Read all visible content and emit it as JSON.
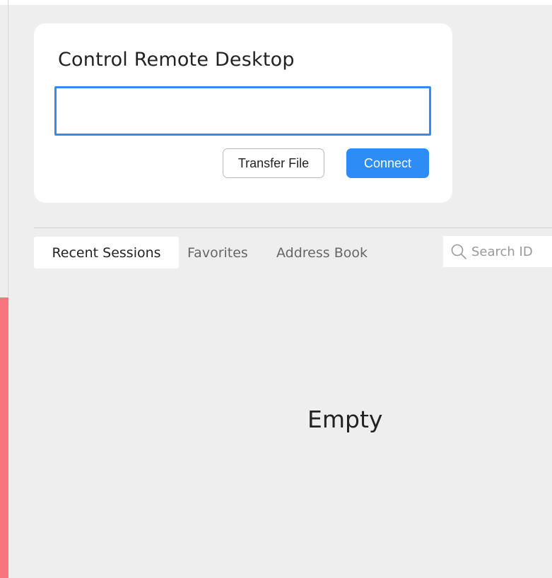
{
  "connect_card": {
    "title": "Control Remote Desktop",
    "id_input_value": "",
    "transfer_file_label": "Transfer File",
    "connect_label": "Connect"
  },
  "sessions": {
    "tabs": [
      {
        "label": "Recent Sessions",
        "active": true
      },
      {
        "label": "Favorites",
        "active": false
      },
      {
        "label": "Address Book",
        "active": false
      }
    ],
    "search_placeholder": "Search ID",
    "empty_message": "Empty"
  },
  "colors": {
    "accent_blue": "#2d8cf6",
    "side_accent": "#f87580",
    "background": "#eeeeee"
  },
  "icons": {
    "search": "search-icon"
  }
}
